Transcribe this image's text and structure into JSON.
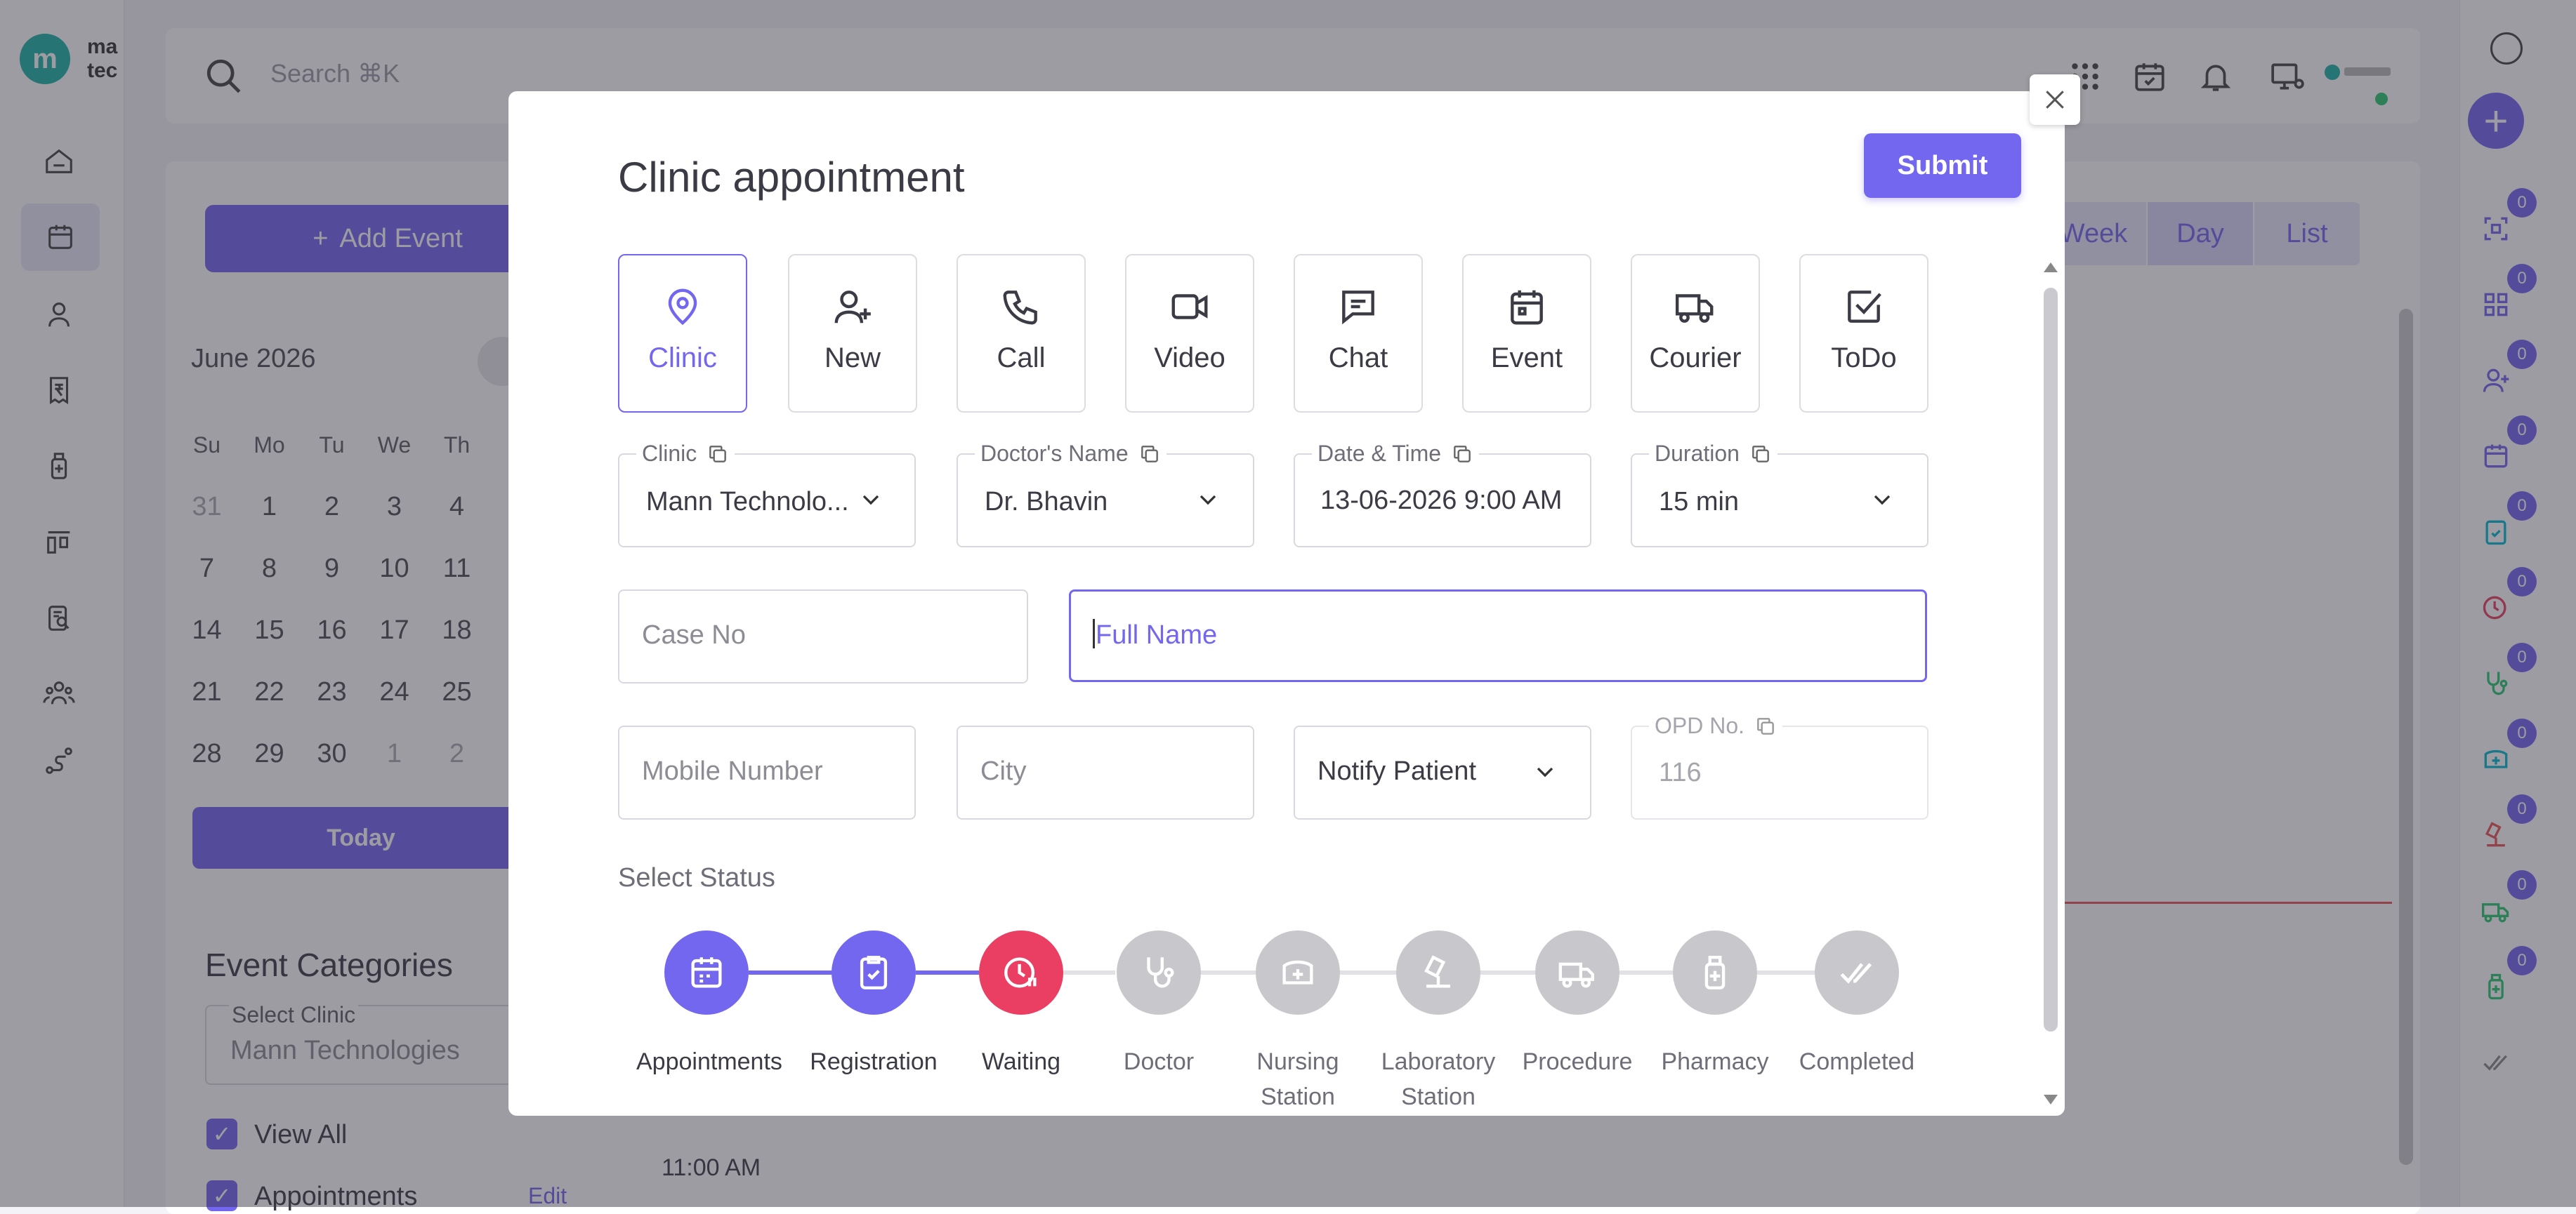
{
  "app": {
    "logo_letter": "m",
    "logo_text_1": "ma",
    "logo_text_2": "tec",
    "search_placeholder": "Search ⌘K",
    "add_event": "Add Event",
    "calendar_month": "June 2026",
    "weekdays": [
      "Su",
      "Mo",
      "Tu",
      "We",
      "Th"
    ],
    "weeks": [
      [
        "31",
        "1",
        "2",
        "3",
        "4"
      ],
      [
        "7",
        "8",
        "9",
        "10",
        "11"
      ],
      [
        "14",
        "15",
        "16",
        "17",
        "18"
      ],
      [
        "21",
        "22",
        "23",
        "24",
        "25"
      ],
      [
        "28",
        "29",
        "30",
        "1",
        "2"
      ]
    ],
    "today_btn": "Today",
    "event_categories": "Event Categories",
    "select_clinic_label": "Select Clinic",
    "select_clinic_value": "Mann Technologies",
    "view_all": "View All",
    "appointments_cat": "Appointments",
    "edit_link": "Edit",
    "views": [
      "Week",
      "Day",
      "List"
    ],
    "active_view": "Day",
    "time_label": "11:00 AM",
    "badge_count": "0",
    "accent": "#7367f0"
  },
  "modal": {
    "title": "Clinic appointment",
    "submit": "Submit",
    "types": [
      {
        "label": "Clinic",
        "icon": "map-pin-icon",
        "selected": true
      },
      {
        "label": "New",
        "icon": "user-plus-icon"
      },
      {
        "label": "Call",
        "icon": "phone-icon"
      },
      {
        "label": "Video",
        "icon": "video-icon"
      },
      {
        "label": "Chat",
        "icon": "chat-icon"
      },
      {
        "label": "Event",
        "icon": "calendar-icon"
      },
      {
        "label": "Courier",
        "icon": "truck-icon"
      },
      {
        "label": "ToDo",
        "icon": "checkbox-icon"
      }
    ],
    "clinic_label": "Clinic",
    "clinic_value": "Mann Technolo...",
    "doctor_label": "Doctor's Name",
    "doctor_value": "Dr. Bhavin",
    "datetime_label": "Date & Time",
    "datetime_value": "13-06-2026 9:00 AM",
    "duration_label": "Duration",
    "duration_value": "15 min",
    "case_no_placeholder": "Case No",
    "full_name_placeholder": "Full Name",
    "mobile_placeholder": "Mobile Number",
    "city_placeholder": "City",
    "notify_placeholder": "Notify Patient",
    "opd_label": "OPD No.",
    "opd_value": "116",
    "select_status": "Select Status",
    "statuses": [
      {
        "label": "Appointments",
        "color": "#7367f0"
      },
      {
        "label": "Registration",
        "color": "#7367f0"
      },
      {
        "label": "Waiting",
        "color": "#ea3f63"
      },
      {
        "label": "Doctor",
        "color": "#c8c8cc"
      },
      {
        "label": "Nursing Station",
        "color": "#c8c8cc"
      },
      {
        "label": "Laboratory Station",
        "color": "#c8c8cc"
      },
      {
        "label": "Procedure",
        "color": "#c8c8cc"
      },
      {
        "label": "Pharmacy",
        "color": "#c8c8cc"
      },
      {
        "label": "Completed",
        "color": "#c8c8cc"
      }
    ]
  }
}
